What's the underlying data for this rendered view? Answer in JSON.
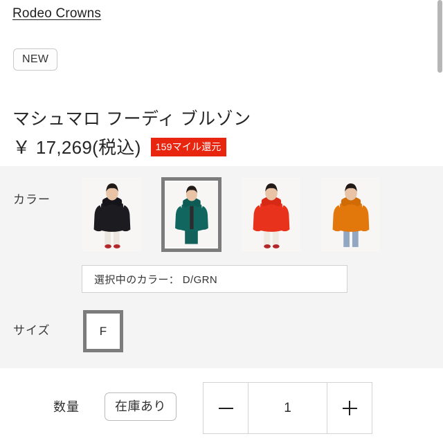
{
  "brand": {
    "name": "Rodeo Crowns"
  },
  "badges": {
    "new_label": "NEW"
  },
  "product": {
    "title": "マシュマロ フーディ ブルゾン",
    "price": "￥ 17,269(税込)",
    "mile_badge": "159マイル還元",
    "mile_badge_color": "#e8250f"
  },
  "color": {
    "label": "カラー",
    "selected_field_text": "選択中のカラー： D/GRN",
    "selected_index": 1,
    "swatches": [
      {
        "name": "BLK",
        "jacket_color": "#1b1b20",
        "hood_color": "#14141a",
        "inner_color": "#f2efe9",
        "pants_color": "#ebe7df",
        "selected": false
      },
      {
        "name": "D/GRN",
        "jacket_color": "#11665f",
        "hood_color": "#0e5a54",
        "inner_color": "#1a1a1a",
        "pants_color": "#14605a",
        "selected": true
      },
      {
        "name": "RED",
        "jacket_color": "#e8321c",
        "hood_color": "#d72a16",
        "inner_color": "#f5f2ec",
        "pants_color": "#efeae2",
        "selected": false
      },
      {
        "name": "ORG",
        "jacket_color": "#e2770c",
        "hood_color": "#d16b06",
        "inner_color": "#9aa2a6",
        "pants_color": "#93a7c2",
        "selected": false
      }
    ]
  },
  "size": {
    "label": "サイズ",
    "options": [
      {
        "label": "F",
        "selected": true
      }
    ]
  },
  "quantity": {
    "label": "数量",
    "stock_label": "在庫あり",
    "value": "1",
    "decrease_icon": "minus-icon",
    "increase_icon": "plus-icon"
  },
  "scrollbar": {
    "thumb_color": "#b6b6b6"
  }
}
